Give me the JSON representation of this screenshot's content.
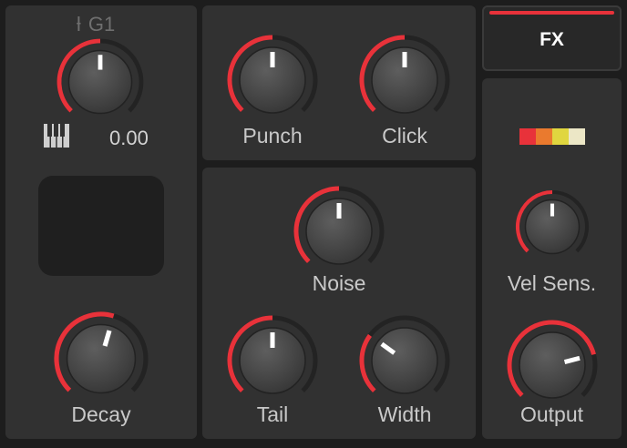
{
  "tuning": {
    "note_label": "G1",
    "value": "0.00",
    "knob": {
      "value": 0.5
    }
  },
  "knobs": {
    "decay": {
      "label": "Decay",
      "value": 0.56
    },
    "punch": {
      "label": "Punch",
      "value": 0.5
    },
    "click": {
      "label": "Click",
      "value": 0.5
    },
    "noise": {
      "label": "Noise",
      "value": 0.5
    },
    "tail": {
      "label": "Tail",
      "value": 0.5
    },
    "width": {
      "label": "Width",
      "value": 0.3
    },
    "vel_sens": {
      "label": "Vel Sens.",
      "value": 0.5
    },
    "output": {
      "label": "Output",
      "value": 0.78
    }
  },
  "fx": {
    "label": "FX"
  },
  "velocity_strip": [
    "#e8323a",
    "#ea7a2e",
    "#e0d63f",
    "#ece7c6"
  ],
  "colors": {
    "accent": "#e8323a",
    "track": "#232323",
    "knob_body": "#4a4a4a",
    "pointer": "#ffffff"
  }
}
